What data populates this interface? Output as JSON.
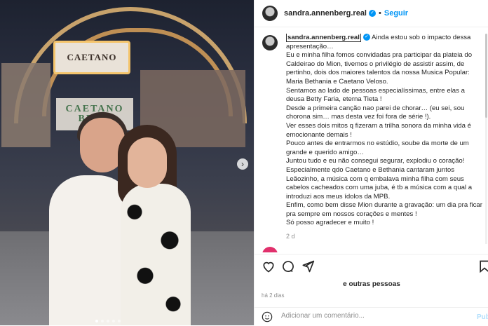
{
  "photo": {
    "stage_sign_top": "CAETANO",
    "stage_sign_mid": "CAETANO\nBETH"
  },
  "header": {
    "username": "sandra.annenberg.real",
    "follow_label": "Seguir",
    "more_label": "···"
  },
  "caption": {
    "username": "sandra.annenberg.real",
    "lines": [
      "Ainda estou sob o impacto dessa apresentação…",
      "Eu e minha filha fomos convidadas pra participar da plateia do Caldeirao do Mion, tivemos o privilégio de assistir assim, de pertinho, dois dos maiores talentos da nossa Musica Popular: Maria Bethania e Caetano Veloso.",
      "Sentamos ao lado de pessoas especialíssimas, entre elas a deusa Betty Faria, eterna Tieta !",
      "Desde a primeira canção nao parei de chorar… (eu sei, sou chorona sim… mas desta vez foi fora de série !).",
      "Ver esses dois mitos q fizeram a trilha sonora da minha vida é emocionante demais !",
      "Pouco antes de entrarmos no estúdio, soube da morte de um grande e querido amigo…",
      "Juntou tudo e eu não consegui segurar, explodiu o coração!",
      "Especialmente qdo Caetano e Bethania cantaram juntos Leãozinho, a música com q embalava minha filha com seus cabelos cacheados com uma juba, é tb a música com a qual a introduzi aos meus ídolos da MPB.",
      "Enfim, como bem disse Mion durante a gravação: um dia pra ficar pra sempre em nossos corações e mentes !",
      "Só posso agradecer e muito !"
    ],
    "time": "2 d"
  },
  "actions": {
    "likes_text": "e outras pessoas",
    "date": "há 2 dias",
    "comment_placeholder": "Adicionar um comentário...",
    "publish_label": "Publicar"
  },
  "icons": [
    "heart-icon",
    "comment-icon",
    "share-icon",
    "save-icon",
    "emoji-icon"
  ]
}
